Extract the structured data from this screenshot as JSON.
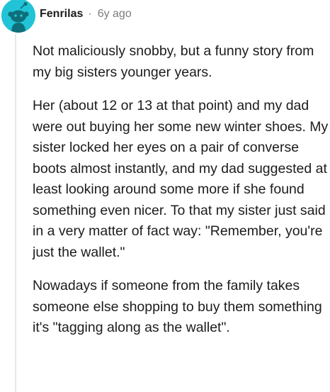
{
  "comment": {
    "author": "Fenrilas",
    "separator": "·",
    "timestamp": "6y ago",
    "avatar_icon": "snoo-avatar-icon",
    "avatar_color": "#21c4d6",
    "paragraphs": [
      "Not maliciously snobby, but a funny story from my big sisters younger years.",
      "Her (about 12 or 13 at that point) and my dad were out buying her some new winter shoes. My sister locked her eyes on a pair of converse boots almost instantly, and my dad suggested at least looking around some more if she found something even nicer. To that my sister just said in a very matter of fact way: \"Remember, you're just the wallet.\"",
      "Nowadays if someone from the family takes someone else shopping to buy them something it's \"tagging along as the wallet\"."
    ]
  }
}
